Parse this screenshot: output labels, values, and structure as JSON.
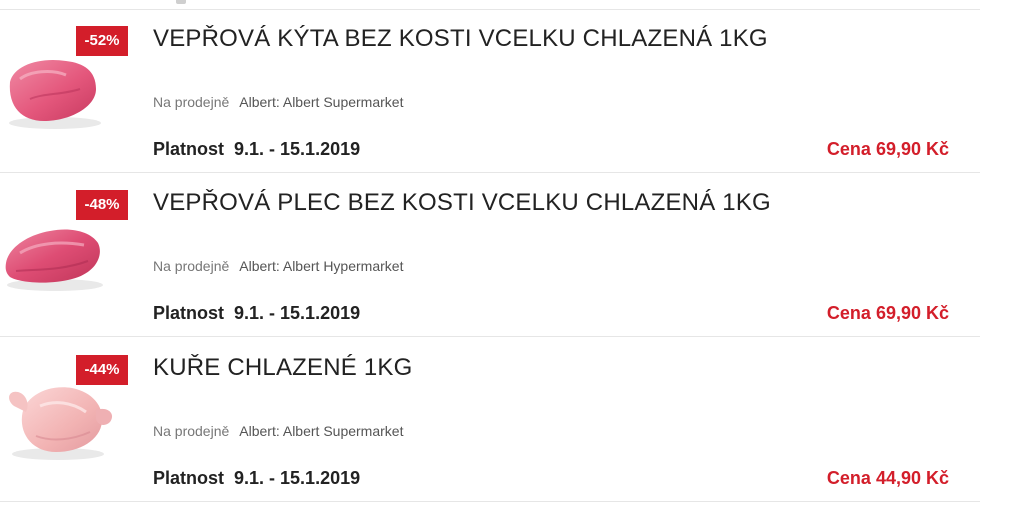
{
  "offers": [
    {
      "discount": "-52%",
      "title": "VEPŘOVÁ KÝTA BEZ KOSTI VCELKU CHLAZENÁ 1KG",
      "store_label": "Na prodejně",
      "store_name": "Albert: Albert Supermarket",
      "validity_label": "Platnost",
      "validity_dates": "9.1. - 15.1.2019",
      "price": "Cena 69,90 Kč",
      "image": "pork-leg-meat"
    },
    {
      "discount": "-48%",
      "title": "VEPŘOVÁ PLEC BEZ KOSTI VCELKU CHLAZENÁ 1KG",
      "store_label": "Na prodejně",
      "store_name": "Albert: Albert Hypermarket",
      "validity_label": "Platnost",
      "validity_dates": "9.1. - 15.1.2019",
      "price": "Cena 69,90 Kč",
      "image": "pork-shoulder-meat"
    },
    {
      "discount": "-44%",
      "title": "KUŘE CHLAZENÉ 1KG",
      "store_label": "Na prodejně",
      "store_name": "Albert: Albert Supermarket",
      "validity_label": "Platnost",
      "validity_dates": "9.1. - 15.1.2019",
      "price": "Cena 44,90 Kč",
      "image": "whole-chicken"
    }
  ],
  "colors": {
    "badge": "#d31e2a",
    "price": "#d31e2a",
    "meat": "#e8557a",
    "chicken": "#f2b8b8"
  }
}
